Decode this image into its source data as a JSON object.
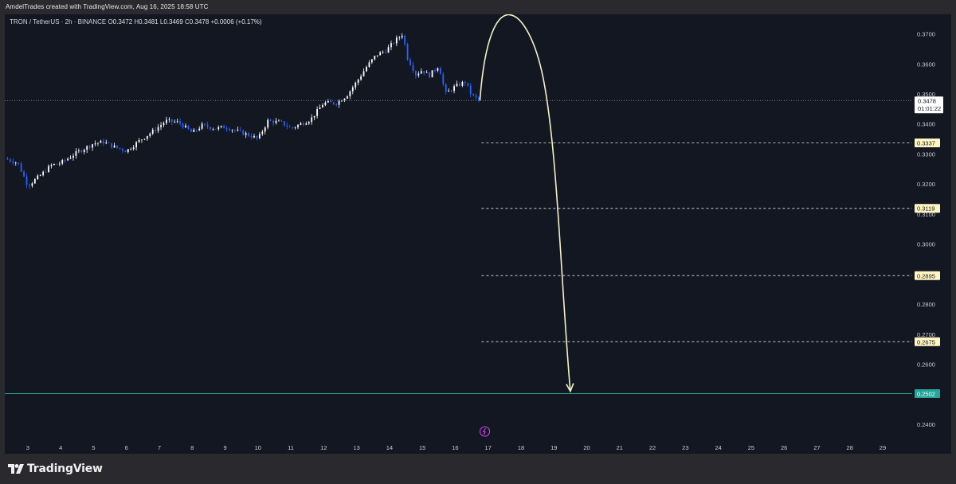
{
  "header": {
    "credit": "AmdelTrades created with TradingView.com, Aug 16, 2025 18:58 UTC"
  },
  "footer": {
    "brand": "TradingView"
  },
  "chart_data": {
    "type": "candlestick",
    "title": "TRON / TetherUS · 2h · BINANCE",
    "ohlc_readout": {
      "O": "0.3472",
      "H": "0.3481",
      "L": "0.3469",
      "C": "0.3478",
      "change": "+0.0006 (+0.17%)"
    },
    "ylim": [
      0.2355,
      0.3765
    ],
    "yticks": [
      0.24,
      0.25,
      0.26,
      0.27,
      0.28,
      0.29,
      0.3,
      0.31,
      0.32,
      0.33,
      0.34,
      0.35,
      0.36,
      0.37
    ],
    "xlim": [
      2.3,
      29.8
    ],
    "xticks": [
      "3",
      "4",
      "5",
      "6",
      "7",
      "8",
      "9",
      "10",
      "11",
      "12",
      "13",
      "14",
      "15",
      "16",
      "17",
      "18",
      "19",
      "20",
      "21",
      "22",
      "23",
      "24",
      "25",
      "26",
      "27",
      "28",
      "29"
    ],
    "grid": false,
    "current_price": {
      "value": 0.3478,
      "label": "0.3478",
      "countdown": "01:01:22"
    },
    "target_levels": [
      {
        "value": 0.3337,
        "label": "0.3337"
      },
      {
        "value": 0.3119,
        "label": "0.3119"
      },
      {
        "value": 0.2895,
        "label": "0.2895"
      },
      {
        "value": 0.2675,
        "label": "0.2675"
      }
    ],
    "support_level": {
      "value": 0.2502,
      "label": "0.2502",
      "color": "#26a69a"
    },
    "projection_path": [
      {
        "day": 16.75,
        "price": 0.3478
      },
      {
        "day": 17.75,
        "price": 0.374
      },
      {
        "day": 18.6,
        "price": 0.315
      },
      {
        "day": 19.5,
        "price": 0.251
      }
    ],
    "price_path": [
      [
        2.3,
        0.3285
      ],
      [
        2.7,
        0.327
      ],
      [
        3.0,
        0.3195
      ],
      [
        3.4,
        0.323
      ],
      [
        3.7,
        0.3262
      ],
      [
        4.0,
        0.327
      ],
      [
        4.5,
        0.3305
      ],
      [
        5.0,
        0.3335
      ],
      [
        5.3,
        0.334
      ],
      [
        5.6,
        0.3325
      ],
      [
        6.0,
        0.331
      ],
      [
        6.4,
        0.3345
      ],
      [
        6.8,
        0.3375
      ],
      [
        7.2,
        0.341
      ],
      [
        7.6,
        0.3405
      ],
      [
        8.0,
        0.337
      ],
      [
        8.3,
        0.3395
      ],
      [
        8.7,
        0.3385
      ],
      [
        9.0,
        0.339
      ],
      [
        9.4,
        0.3375
      ],
      [
        9.8,
        0.336
      ],
      [
        10.0,
        0.335
      ],
      [
        10.3,
        0.341
      ],
      [
        10.7,
        0.3405
      ],
      [
        11.0,
        0.3385
      ],
      [
        11.3,
        0.34
      ],
      [
        11.6,
        0.3415
      ],
      [
        12.0,
        0.347
      ],
      [
        12.4,
        0.347
      ],
      [
        12.7,
        0.3495
      ],
      [
        13.0,
        0.354
      ],
      [
        13.3,
        0.359
      ],
      [
        13.6,
        0.363
      ],
      [
        13.9,
        0.3645
      ],
      [
        14.2,
        0.368
      ],
      [
        14.4,
        0.37
      ],
      [
        14.55,
        0.362
      ],
      [
        14.8,
        0.3565
      ],
      [
        15.0,
        0.358
      ],
      [
        15.2,
        0.356
      ],
      [
        15.5,
        0.3595
      ],
      [
        15.7,
        0.35
      ],
      [
        16.0,
        0.3525
      ],
      [
        16.3,
        0.354
      ],
      [
        16.5,
        0.3495
      ],
      [
        16.75,
        0.3478
      ]
    ],
    "colors": {
      "up": "#ffffff",
      "down": "#2962ff",
      "projection": "#f5f0c8",
      "background": "#131722"
    }
  }
}
